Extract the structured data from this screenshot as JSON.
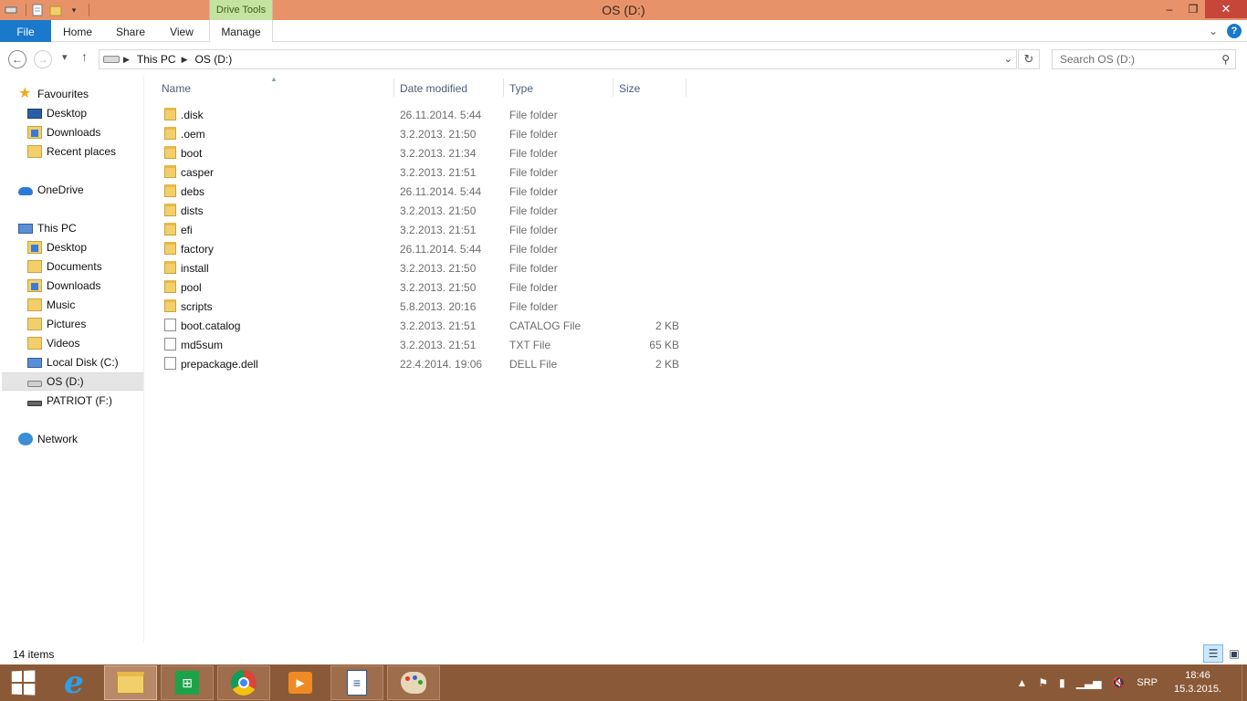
{
  "window": {
    "title": "OS (D:)",
    "context_tab": "Drive Tools"
  },
  "ribbon": {
    "tabs": [
      "File",
      "Home",
      "Share",
      "View",
      "Manage"
    ]
  },
  "address": {
    "crumbs": [
      "This PC",
      "OS (D:)"
    ],
    "search_placeholder": "Search OS (D:)"
  },
  "nav": {
    "favourites": "Favourites",
    "fav_items": [
      "Desktop",
      "Downloads",
      "Recent places"
    ],
    "onedrive": "OneDrive",
    "thispc": "This PC",
    "pc_items": [
      "Desktop",
      "Documents",
      "Downloads",
      "Music",
      "Pictures",
      "Videos",
      "Local Disk (C:)",
      "OS (D:)",
      "PATRIOT (F:)"
    ],
    "network": "Network",
    "selected": "OS (D:)"
  },
  "columns": {
    "name": "Name",
    "date": "Date modified",
    "type": "Type",
    "size": "Size"
  },
  "files": [
    {
      "name": ".disk",
      "date": "26.11.2014. 5:44",
      "type": "File folder",
      "size": "",
      "kind": "folder"
    },
    {
      "name": ".oem",
      "date": "3.2.2013. 21:50",
      "type": "File folder",
      "size": "",
      "kind": "folder"
    },
    {
      "name": "boot",
      "date": "3.2.2013. 21:34",
      "type": "File folder",
      "size": "",
      "kind": "folder"
    },
    {
      "name": "casper",
      "date": "3.2.2013. 21:51",
      "type": "File folder",
      "size": "",
      "kind": "folder"
    },
    {
      "name": "debs",
      "date": "26.11.2014. 5:44",
      "type": "File folder",
      "size": "",
      "kind": "folder"
    },
    {
      "name": "dists",
      "date": "3.2.2013. 21:50",
      "type": "File folder",
      "size": "",
      "kind": "folder"
    },
    {
      "name": "efi",
      "date": "3.2.2013. 21:51",
      "type": "File folder",
      "size": "",
      "kind": "folder"
    },
    {
      "name": "factory",
      "date": "26.11.2014. 5:44",
      "type": "File folder",
      "size": "",
      "kind": "folder"
    },
    {
      "name": "install",
      "date": "3.2.2013. 21:50",
      "type": "File folder",
      "size": "",
      "kind": "folder"
    },
    {
      "name": "pool",
      "date": "3.2.2013. 21:50",
      "type": "File folder",
      "size": "",
      "kind": "folder"
    },
    {
      "name": "scripts",
      "date": "5.8.2013. 20:16",
      "type": "File folder",
      "size": "",
      "kind": "folder"
    },
    {
      "name": "boot.catalog",
      "date": "3.2.2013. 21:51",
      "type": "CATALOG File",
      "size": "2 KB",
      "kind": "file"
    },
    {
      "name": "md5sum",
      "date": "3.2.2013. 21:51",
      "type": "TXT File",
      "size": "65 KB",
      "kind": "file"
    },
    {
      "name": "prepackage.dell",
      "date": "22.4.2014. 19:06",
      "type": "DELL File",
      "size": "2 KB",
      "kind": "file"
    }
  ],
  "status": {
    "count": "14 items"
  },
  "taskbar": {
    "apps": [
      "start-icon",
      "internet-explorer-icon",
      "file-explorer-icon",
      "store-icon",
      "chrome-icon",
      "media-player-icon",
      "writer-icon",
      "paint-icon"
    ],
    "lang": "SRP",
    "time": "18:46",
    "date": "15.3.2015."
  },
  "colors": {
    "titlebar": "#e8926a",
    "context_tab": "#c5e3a0",
    "file_tab": "#1979ca",
    "taskbar": "#8a5a38",
    "close": "#c6463a"
  }
}
